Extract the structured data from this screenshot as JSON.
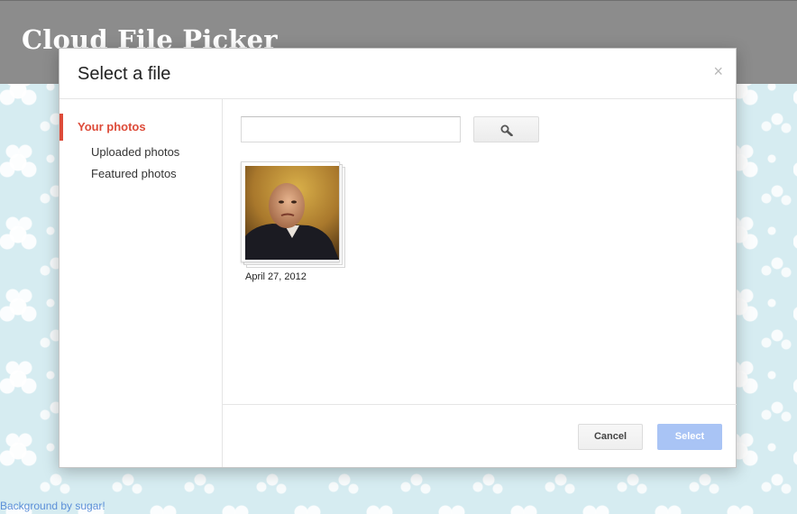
{
  "header": {
    "app_title": "Cloud File Picker"
  },
  "dialog": {
    "title": "Select a file",
    "close_glyph": "×",
    "nav": {
      "items": [
        {
          "label": "Your photos",
          "active": true
        },
        {
          "label": "Uploaded photos",
          "active": false
        },
        {
          "label": "Featured photos",
          "active": false
        }
      ]
    },
    "search": {
      "value": "",
      "placeholder": "",
      "button_icon": "search-icon"
    },
    "photos": [
      {
        "date": "April 27, 2012"
      }
    ],
    "footer": {
      "cancel_label": "Cancel",
      "select_label": "Select",
      "select_enabled": false
    }
  },
  "page_footer": {
    "credit_link": "Background by sugar!"
  },
  "colors": {
    "accent_active": "#dd4b39",
    "select_disabled": "#a9c4f5",
    "topbar": "#8c8c8c",
    "background": "#d6ecf1"
  }
}
